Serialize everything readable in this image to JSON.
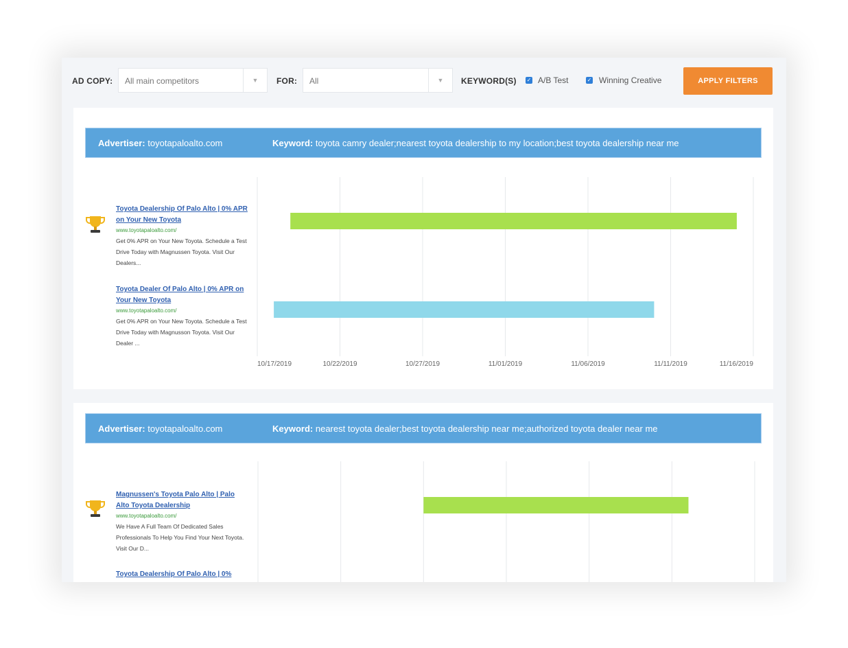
{
  "filters": {
    "ad_copy_label": "AD COPY:",
    "ad_copy_value": "All main competitors",
    "for_label": "FOR:",
    "for_value": "All",
    "keywords_label": "KEYWORD(S)",
    "ab_test_label": "A/B Test",
    "ab_test_checked": true,
    "winning_label": "Winning Creative",
    "winning_checked": true,
    "apply_label": "APPLY FILTERS"
  },
  "colors": {
    "bar_green": "#a8e04e",
    "bar_blue": "#8fd8ea",
    "header_blue": "#5aa4dc",
    "apply_orange": "#f08a32"
  },
  "ticks": [
    "10/17/2019",
    "10/22/2019",
    "10/27/2019",
    "11/01/2019",
    "11/06/2019",
    "11/11/2019",
    "11/16/2019"
  ],
  "cards": [
    {
      "advertiser_label": "Advertiser:",
      "advertiser": "toyotapaloalto.com",
      "keyword_label": "Keyword:",
      "keyword": "toyota camry dealer;nearest toyota dealership to my location;best toyota dealership near me",
      "ads": [
        {
          "title": "Toyota Dealership Of Palo Alto | 0% APR on Your New Toyota",
          "url": "www.toyotapaloalto.com/",
          "desc": "Get 0% APR on Your New Toyota. Schedule a Test Drive Today with Magnussen Toyota. Visit Our Dealers...",
          "winner": true
        },
        {
          "title": "Toyota Dealer Of Palo Alto | 0% APR on Your New Toyota",
          "url": "www.toyotapaloalto.com/",
          "desc": "Get 0% APR on Your New Toyota. Schedule a Test Drive Today with Magnusson Toyota. Visit Our Dealer ...",
          "winner": false
        }
      ]
    },
    {
      "advertiser_label": "Advertiser:",
      "advertiser": "toyotapaloalto.com",
      "keyword_label": "Keyword:",
      "keyword": "nearest toyota dealer;best toyota dealership near me;authorized toyota dealer near me",
      "ads": [
        {
          "title": "Magnussen's Toyota Palo Alto | Palo Alto Toyota Dealership",
          "url": "www.toyotapaloalto.com/",
          "desc": "We Have A Full Team Of Dedicated Sales Professionals To Help You Find Your Next Toyota. Visit Our D...",
          "winner": true
        },
        {
          "title": "Toyota Dealership Of Palo Alto | 0%",
          "url": "",
          "desc": "",
          "winner": false
        }
      ]
    }
  ],
  "chart_data": [
    {
      "type": "bar",
      "orientation": "horizontal-timeline",
      "x_range": [
        "10/17/2019",
        "11/16/2019"
      ],
      "series": [
        {
          "start": "10/19/2019",
          "end": "11/15/2019",
          "color": "#a8e04e"
        },
        {
          "start": "10/18/2019",
          "end": "11/10/2019",
          "color": "#8fd8ea"
        }
      ]
    },
    {
      "type": "bar",
      "orientation": "horizontal-timeline",
      "x_range": [
        "10/17/2019",
        "11/16/2019"
      ],
      "series": [
        {
          "start": "10/27/2019",
          "end": "11/12/2019",
          "color": "#a8e04e"
        }
      ]
    }
  ]
}
